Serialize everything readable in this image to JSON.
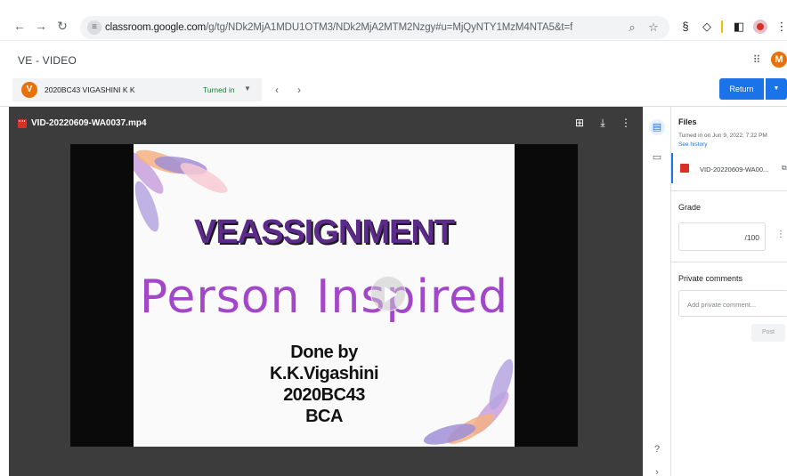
{
  "browser": {
    "url_host": "classroom.google.com",
    "url_path": "/g/tg/NDk2MjA1MDU1OTM3/NDk2MjA2MTM2Nzgy#u=MjQyNTY1MzM4NTA5&t=f"
  },
  "app": {
    "title": "VE - VIDEO",
    "user_initial": "M"
  },
  "student": {
    "initial": "V",
    "name": "2020BC43 VIGASHINI K K",
    "status": "Turned in"
  },
  "toolbar": {
    "return_label": "Return"
  },
  "viewer": {
    "file_name": "VID-20220609-WA0037.mp4",
    "frame": {
      "line1": "VEASSIGNMENT",
      "line2": "Person Inspired",
      "line3": "Done by",
      "line4": "K.K.Vigashini",
      "line5": "2020BC43",
      "line6": "BCA"
    }
  },
  "panel": {
    "files_heading": "Files",
    "turned_in": "Turned in on Jun 9, 2022, 7:22 PM",
    "see_history": "See history",
    "attachment_name": "VID-20220609-WA00...",
    "grade_heading": "Grade",
    "grade_value": "/100",
    "comments_heading": "Private comments",
    "comment_placeholder": "Add private comment...",
    "post_label": "Post"
  },
  "colors": {
    "accent": "#1a73e8",
    "avatar": "#e8710a",
    "turned_in": "#188038",
    "viewer_bg": "#3c3c3c"
  }
}
